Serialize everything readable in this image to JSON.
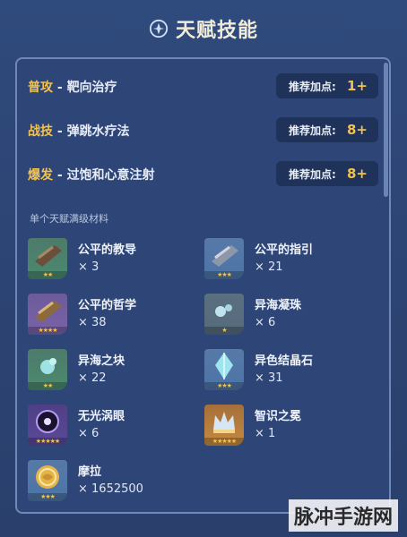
{
  "header": {
    "title": "天赋技能",
    "icon": "sparkle-emblem-icon"
  },
  "skills": [
    {
      "type": "普攻",
      "sep": " - ",
      "name": "靶向治疗",
      "rec_label": "推荐加点:",
      "rec_value": "1+"
    },
    {
      "type": "战技",
      "sep": " - ",
      "name": "弹跳水疗法",
      "rec_label": "推荐加点:",
      "rec_value": "8+"
    },
    {
      "type": "爆发",
      "sep": " - ",
      "name": "过饱和心意注射",
      "rec_label": "推荐加点:",
      "rec_value": "8+"
    }
  ],
  "materials_title": "单个天赋满级材料",
  "materials": [
    {
      "name": "公平的教导",
      "qty": "× 3",
      "stars": "★★",
      "icon": "book-scroll-icon"
    },
    {
      "name": "公平的指引",
      "qty": "× 21",
      "stars": "★★★",
      "icon": "book-scroll-icon"
    },
    {
      "name": "公平的哲学",
      "qty": "× 38",
      "stars": "★★★★",
      "icon": "book-scroll-icon"
    },
    {
      "name": "异海凝珠",
      "qty": "× 6",
      "stars": "★",
      "icon": "water-droplet-icon"
    },
    {
      "name": "异海之块",
      "qty": "× 22",
      "stars": "★★",
      "icon": "water-droplet-icon"
    },
    {
      "name": "异色结晶石",
      "qty": "× 31",
      "stars": "★★★",
      "icon": "crystal-icon"
    },
    {
      "name": "无光涡眼",
      "qty": "× 6",
      "stars": "★★★★★",
      "icon": "vortex-eye-icon"
    },
    {
      "name": "智识之冕",
      "qty": "× 1",
      "stars": "★★★★★",
      "icon": "crown-icon"
    },
    {
      "name": "摩拉",
      "qty": "× 1652500",
      "stars": "★★★",
      "icon": "mora-coin-icon"
    }
  ],
  "watermark": "脉冲手游网"
}
